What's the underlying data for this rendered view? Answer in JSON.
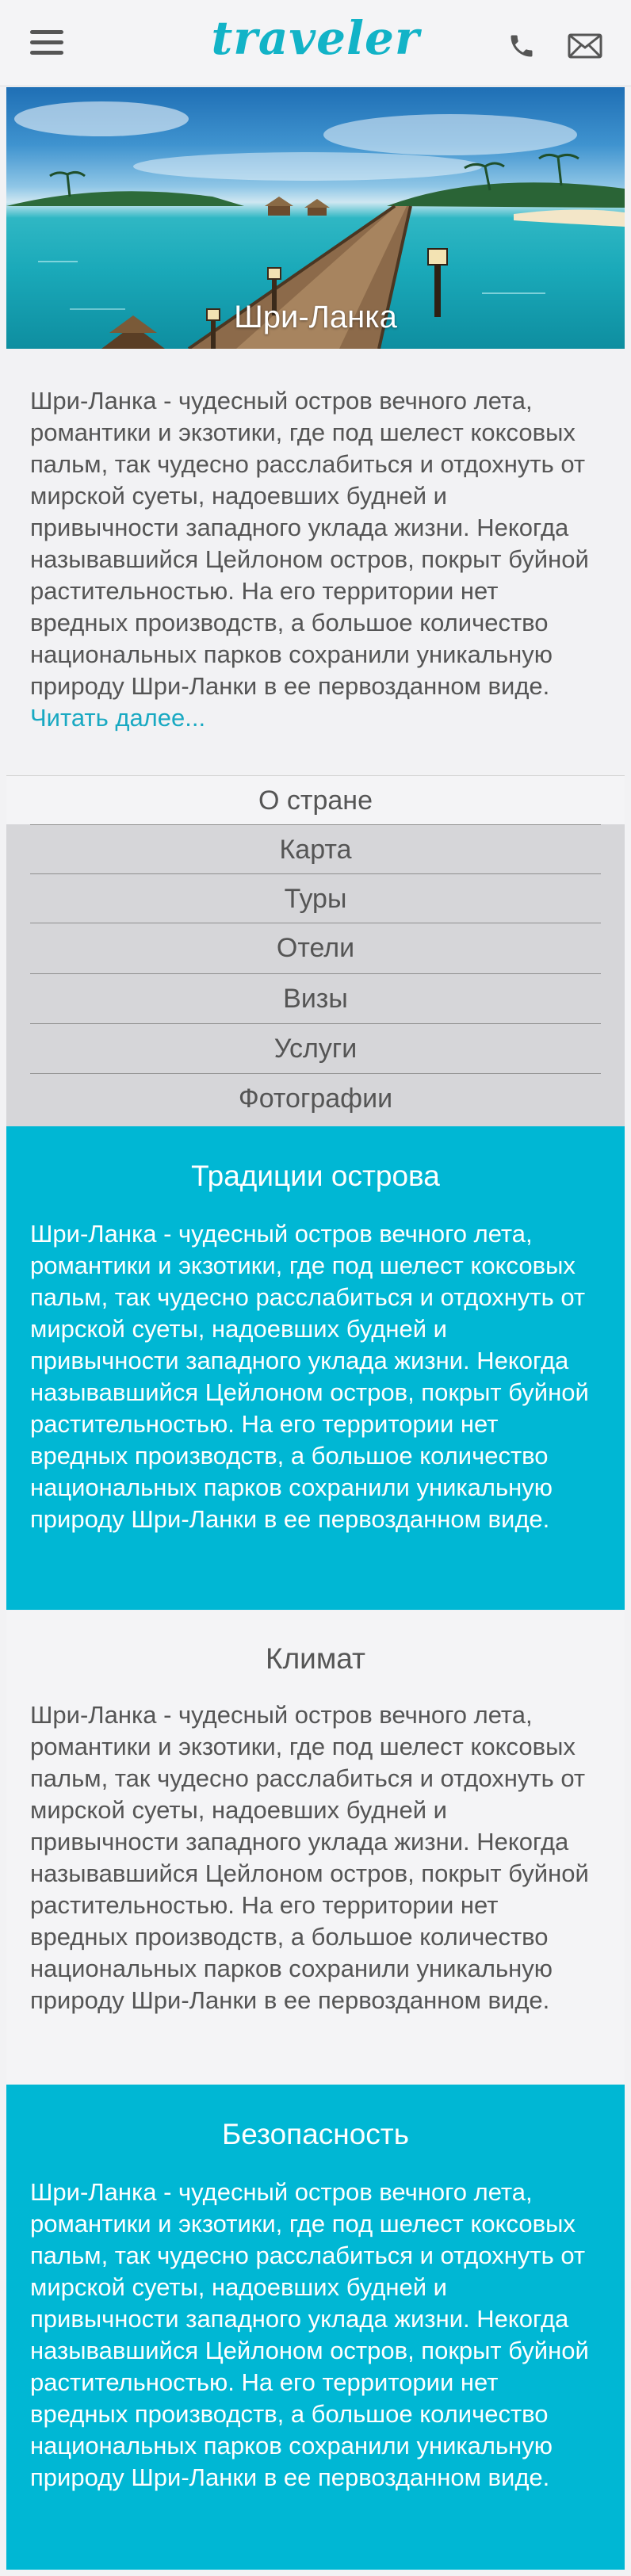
{
  "header": {
    "logo": "traveler",
    "menu_icon": "hamburger-menu-icon",
    "phone_icon": "phone-icon",
    "mail_icon": "mail-icon"
  },
  "hero": {
    "title": "Шри-Ланка"
  },
  "intro": {
    "text": "Шри-Ланка - чудесный остров вечного лета, романтики и экзотики, где под шелест коксовых пальм, так чудесно расслабиться и отдохнуть от мирской суеты, надоевших будней и привычности западного уклада жизни. Некогда называвшийся Цейлоном остров, покрыт буйной растительностью. На его территории нет вредных производств, а большое количество национальных парков сохранили уникальную природу Шри-Ланки в ее первозданном виде.",
    "read_more": "Читать далее..."
  },
  "nav": {
    "active": "О стране",
    "items": [
      "Карта",
      "Туры",
      "Отели",
      "Визы",
      "Услуги",
      "Фотографии"
    ]
  },
  "sections": [
    {
      "title": "Традиции острова",
      "text": "Шри-Ланка - чудесный остров вечного лета, романтики и экзотики, где под шелест коксовых пальм, так чудесно расслабиться и отдохнуть от мирской суеты, надоевших будней и привычности западного уклада жизни. Некогда называвшийся Цейлоном остров, покрыт буйной растительностью. На его территории нет вредных производств, а большое количество национальных парков сохранили уникальную природу Шри-Ланки в ее первозданном виде."
    },
    {
      "title": "Климат",
      "text": "Шри-Ланка - чудесный остров вечного лета, романтики и экзотики, где под шелест коксовых пальм, так чудесно расслабиться и отдохнуть от мирской суеты, надоевших будней и привычности западного уклада жизни. Некогда называвшийся Цейлоном остров, покрыт буйной растительностью. На его территории нет вредных производств, а большое количество национальных парков сохранили уникальную природу Шри-Ланки в ее первозданном виде."
    },
    {
      "title": "Безопасность",
      "text": "Шри-Ланка - чудесный остров вечного лета, романтики и экзотики, где под шелест коксовых пальм, так чудесно расслабиться и отдохнуть от мирской суеты, надоевших будней и привычности западного уклада жизни. Некогда называвшийся Цейлоном остров, покрыт буйной растительностью. На его территории нет вредных производств, а большое количество национальных парков сохранили уникальную природу Шри-Ланки в ее первозданном виде."
    }
  ],
  "colors": {
    "accent": "#12b3c7",
    "section_teal": "#00b7d4",
    "nav_bg": "#d6d6d9",
    "page_bg": "#f2f2f4"
  }
}
